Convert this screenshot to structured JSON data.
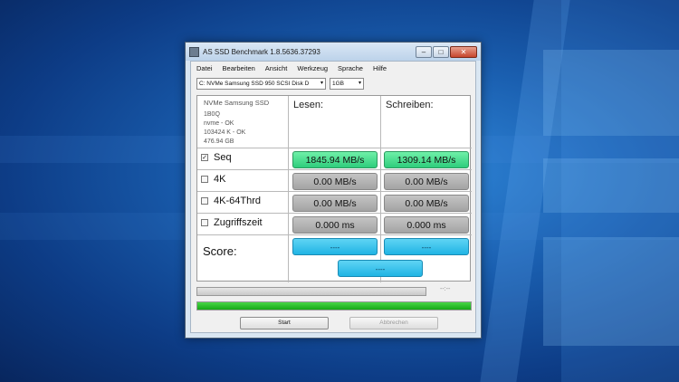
{
  "window": {
    "title": "AS SSD Benchmark 1.8.5636.37293",
    "min_symbol": "–",
    "max_symbol": "□",
    "close_symbol": "✕"
  },
  "menu": [
    "Datei",
    "Bearbeiten",
    "Ansicht",
    "Werkzeug",
    "Sprache",
    "Hilfe"
  ],
  "toolbar": {
    "drive_value": "C: NVMe Samsung SSD 950 SCSI Disk D",
    "size_value": "1GB",
    "arrow": "▾"
  },
  "drive_info": {
    "name": "NVMe Samsung SSD",
    "firmware": "1B0Q",
    "driver": "nvme - OK",
    "alignment": "103424 K - OK",
    "capacity": "476.94 GB"
  },
  "columns": {
    "read": "Lesen:",
    "write": "Schreiben:"
  },
  "tests": [
    {
      "label": "Seq",
      "checked": true,
      "check_mark": "✓",
      "read": "1845.94 MB/s",
      "write": "1309.14 MB/s"
    },
    {
      "label": "4K",
      "checked": false,
      "check_mark": "",
      "read": "0.00 MB/s",
      "write": "0.00 MB/s"
    },
    {
      "label": "4K-64Thrd",
      "checked": false,
      "check_mark": "",
      "read": "0.00 MB/s",
      "write": "0.00 MB/s"
    },
    {
      "label": "Zugriffszeit",
      "checked": false,
      "check_mark": "",
      "read": "0.000 ms",
      "write": "0.000 ms"
    }
  ],
  "score": {
    "label": "Score:",
    "read": "----",
    "write": "----",
    "total": "----"
  },
  "progress": {
    "timer": "--:--",
    "overall_fraction": 1.0
  },
  "buttons": {
    "start": "Start",
    "abort": "Abbrechen"
  },
  "colors": {
    "green": "#2fcd7c",
    "blue": "#20b4e4",
    "gray": "#a3a3a3",
    "progress": "#17a917"
  }
}
